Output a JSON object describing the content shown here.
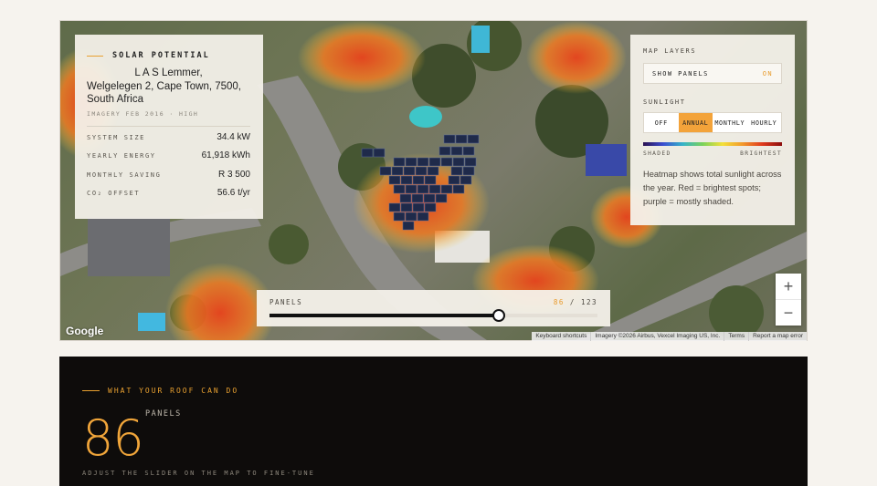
{
  "info": {
    "heading": "SOLAR POTENTIAL",
    "address_line1": "L A S Lemmer,",
    "address_line2": "Welgelegen 2, Cape Town, 7500, South Africa",
    "imagery": "IMAGERY FEB 2016 · HIGH",
    "stats": [
      {
        "label": "SYSTEM SIZE",
        "value": "34.4 kW"
      },
      {
        "label": "YEARLY ENERGY",
        "value": "61,918 kWh"
      },
      {
        "label": "MONTHLY SAVING",
        "value": "R 3 500"
      },
      {
        "label": "CO₂ OFFSET",
        "value": "56.6 t/yr"
      }
    ]
  },
  "layers": {
    "heading": "MAP LAYERS",
    "panels_toggle_label": "SHOW PANELS",
    "panels_toggle_state": "ON",
    "sunlight_heading": "SUNLIGHT",
    "sunlight_options": [
      "OFF",
      "ANNUAL",
      "MONTHLY",
      "HOURLY"
    ],
    "sunlight_selected": "ANNUAL",
    "scale_low": "SHADED",
    "scale_high": "BRIGHTEST",
    "note": "Heatmap shows total sunlight across the year. Red = brightest spots; purple = mostly shaded."
  },
  "slider": {
    "label": "PANELS",
    "count": "86",
    "sep": "/",
    "total": "123",
    "value_fraction": 0.699
  },
  "zoom": {
    "in": "+",
    "out": "−"
  },
  "map": {
    "logo": "Google",
    "attribution": [
      "Keyboard shortcuts",
      "Imagery ©2026 Airbus, Vexcel Imaging US, Inc.",
      "Terms",
      "Report a map error"
    ]
  },
  "summary": {
    "eyebrow": "WHAT YOUR ROOF CAN DO",
    "count": "86",
    "unit": "PANELS",
    "hint": "ADJUST THE SLIDER ON THE MAP TO FINE-TUNE"
  },
  "colors": {
    "accent": "#f3a33a",
    "dark": "#0e0c0b"
  }
}
